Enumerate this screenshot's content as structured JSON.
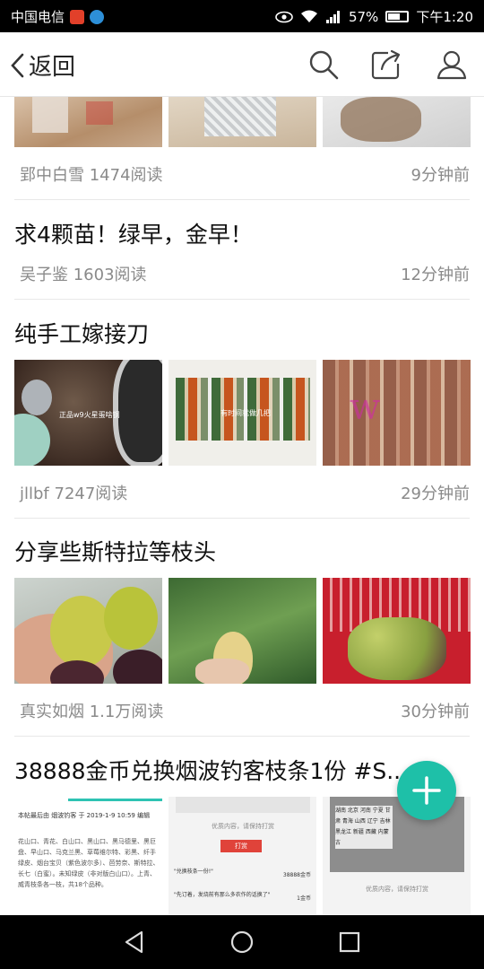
{
  "status_bar": {
    "carrier": "中国电信",
    "battery": "57%",
    "time": "下午1:20",
    "icons": [
      "app-red-icon",
      "app-blue-icon",
      "eye-icon",
      "wifi-icon",
      "signal-icon",
      "battery-icon"
    ]
  },
  "header": {
    "back_label": "返回",
    "icons": [
      "search-icon",
      "share-icon",
      "user-icon"
    ]
  },
  "posts": [
    {
      "title": "",
      "author_reads": "郢中白雪 1474阅读",
      "time_ago": "9分钟前"
    },
    {
      "title": "求4颗苗！绿早，金早！",
      "author_reads": "吴子鉴 1603阅读",
      "time_ago": "12分钟前"
    },
    {
      "title": "纯手工嫁接刀",
      "author_reads": "jllbf 7247阅读",
      "time_ago": "29分钟前",
      "image_captions": [
        "正品w9火星蛋啥钢",
        "有时间就做几把",
        ""
      ]
    },
    {
      "title": "分享些斯特拉等枝头",
      "author_reads": "真实如烟 1.1万阅读",
      "time_ago": "30分钟前"
    },
    {
      "title": "38888金币兑换烟波钓客枝条1份 #S...",
      "author_reads": "",
      "time_ago": "",
      "screenshot_text": {
        "header": "本帖最后由 烟波钓客 于 2019-1-9 10:59 编辑",
        "body": "花山口、青花、白山口、黑山口、黑马德里、黑巨盘、早山口、马克兰黑、草莓维尔特、彩黑、纤手绿皮、烟台宝贝（紫色波尔多）、芭劳奈、斯特拉、长七（白蜜）。未知绿皮（非对版白山口）。上青、威青枝条各一枝，共18个品种。",
        "button": "打赏",
        "hint": "优质内容，请保持打赏",
        "reply1": "\"兑换枝条一份!\"",
        "reply2": "\"先订着，发烧前有那么多农作的话换了\"",
        "coins": "38888金币",
        "coins2": "1金币",
        "regions": "湖南 北京 河南 宁夏 甘肃 青海 山西 辽宁 吉林 黑龙江 新疆 西藏 内蒙古"
      }
    }
  ],
  "fab_label": "+",
  "nav_icons": [
    "back-triangle-icon",
    "home-circle-icon",
    "recents-square-icon"
  ]
}
